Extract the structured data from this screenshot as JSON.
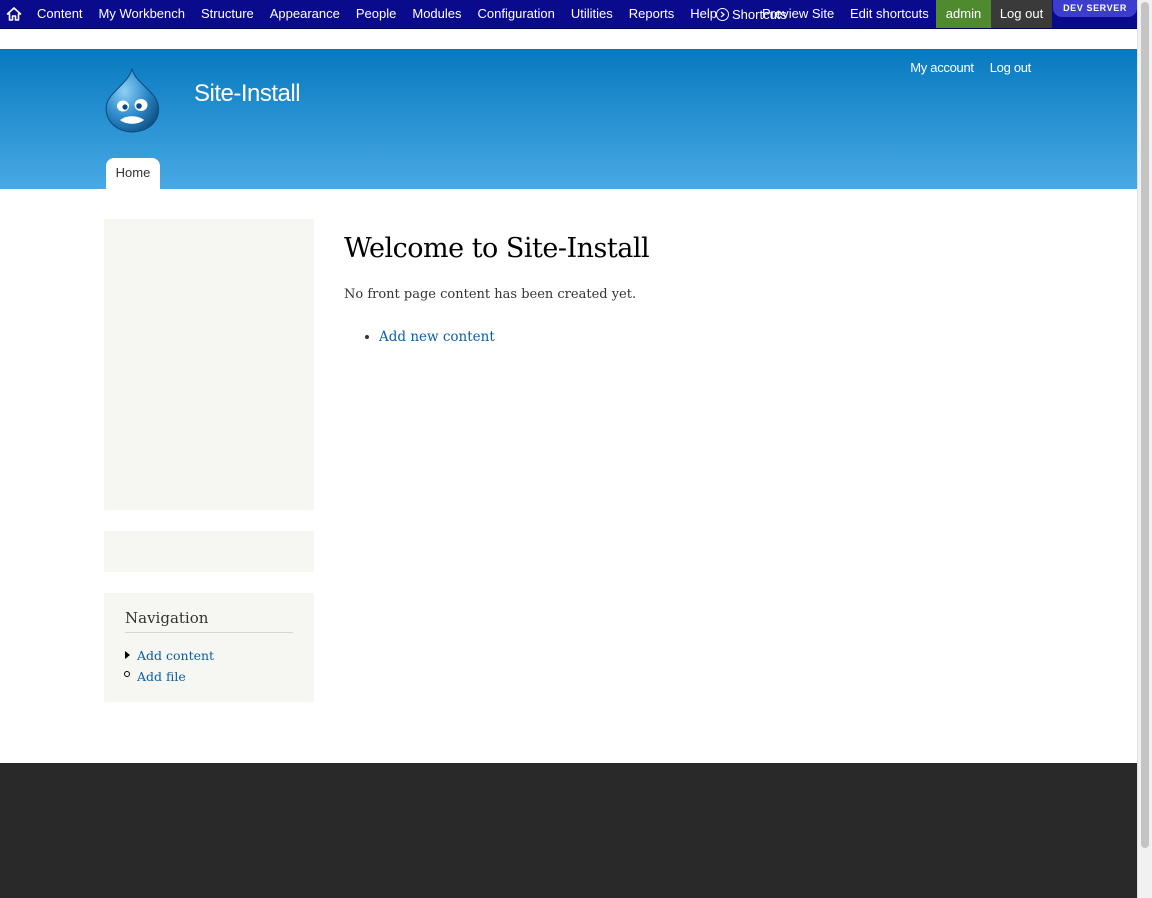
{
  "toolbar": {
    "menu": [
      {
        "label": "Content"
      },
      {
        "label": "My Workbench"
      },
      {
        "label": "Structure"
      },
      {
        "label": "Appearance"
      },
      {
        "label": "People"
      },
      {
        "label": "Modules"
      },
      {
        "label": "Configuration"
      },
      {
        "label": "Utilities"
      },
      {
        "label": "Reports"
      },
      {
        "label": "Help"
      }
    ],
    "shortcuts_label": "Shortcuts",
    "preview_label": "Preview Site",
    "edit_shortcuts_label": "Edit shortcuts",
    "user_label": "admin",
    "logout_label": "Log out",
    "env_badge": "DEV SERVER",
    "colors": {
      "background": "#0a0a8c",
      "user": "#4f8a2f",
      "logout": "#3a3a3a",
      "badge": "#3c3ccf"
    }
  },
  "header": {
    "site_name": "Site-Install",
    "logo_icon": "drupal-drop-icon",
    "secondary_menu": [
      {
        "label": "My account"
      },
      {
        "label": "Log out"
      }
    ],
    "main_tabs": [
      {
        "label": "Home"
      }
    ],
    "colors": {
      "gradient_top": "#0779bf",
      "gradient_bottom": "#48a9e4"
    }
  },
  "sidebar": {
    "navigation": {
      "title": "Navigation",
      "items": [
        {
          "label": "Add content"
        },
        {
          "label": "Add file"
        }
      ]
    }
  },
  "main": {
    "title": "Welcome to Site-Install",
    "message": "No front page content has been created yet.",
    "links": [
      {
        "label": "Add new content"
      }
    ]
  },
  "footer": {
    "color": "#292929"
  }
}
